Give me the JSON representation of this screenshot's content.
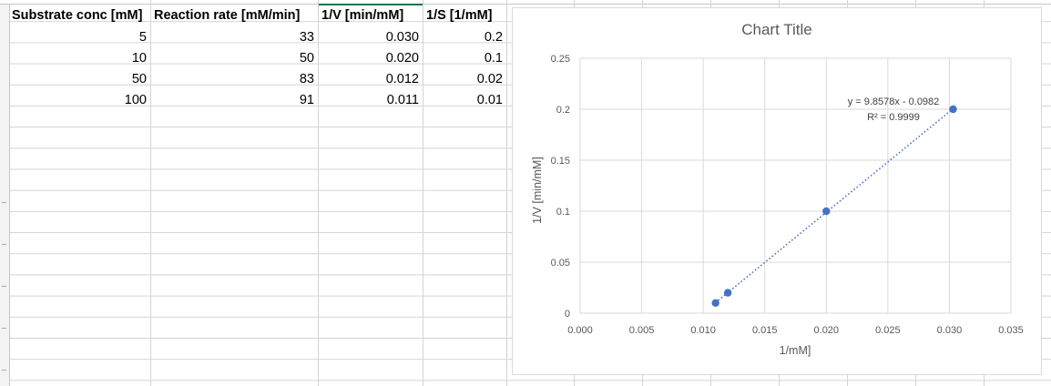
{
  "table": {
    "headers": [
      "Substrate conc [mM]",
      "Reaction rate [mM/min]",
      "1/V [min/mM]",
      "1/S [1/mM]"
    ],
    "rows": [
      [
        "5",
        "33",
        "0.030",
        "0.2"
      ],
      [
        "10",
        "50",
        "0.020",
        "0.1"
      ],
      [
        "50",
        "83",
        "0.012",
        "0.02"
      ],
      [
        "100",
        "91",
        "0.011",
        "0.01"
      ]
    ]
  },
  "chart_data": {
    "type": "scatter",
    "title": "Chart Title",
    "xlabel": "1/mM]",
    "ylabel": "1/V [min/mM]",
    "xlim": [
      0,
      0.035
    ],
    "ylim": [
      0,
      0.25
    ],
    "x_ticks": [
      "0.000",
      "0.005",
      "0.010",
      "0.015",
      "0.020",
      "0.025",
      "0.030",
      "0.035"
    ],
    "y_ticks": [
      "0",
      "0.05",
      "0.1",
      "0.15",
      "0.2",
      "0.25"
    ],
    "grid": true,
    "series": [
      {
        "points": [
          [
            0.0303,
            0.2
          ],
          [
            0.02,
            0.1
          ],
          [
            0.012,
            0.02
          ],
          [
            0.011,
            0.01
          ]
        ],
        "color": "#4472c4"
      }
    ],
    "trendline": {
      "type": "linear",
      "style": "dotted",
      "color": "#4472c4",
      "equation": "y = 9.8578x - 0.0982",
      "r_squared": "R² = 0.9999"
    }
  }
}
